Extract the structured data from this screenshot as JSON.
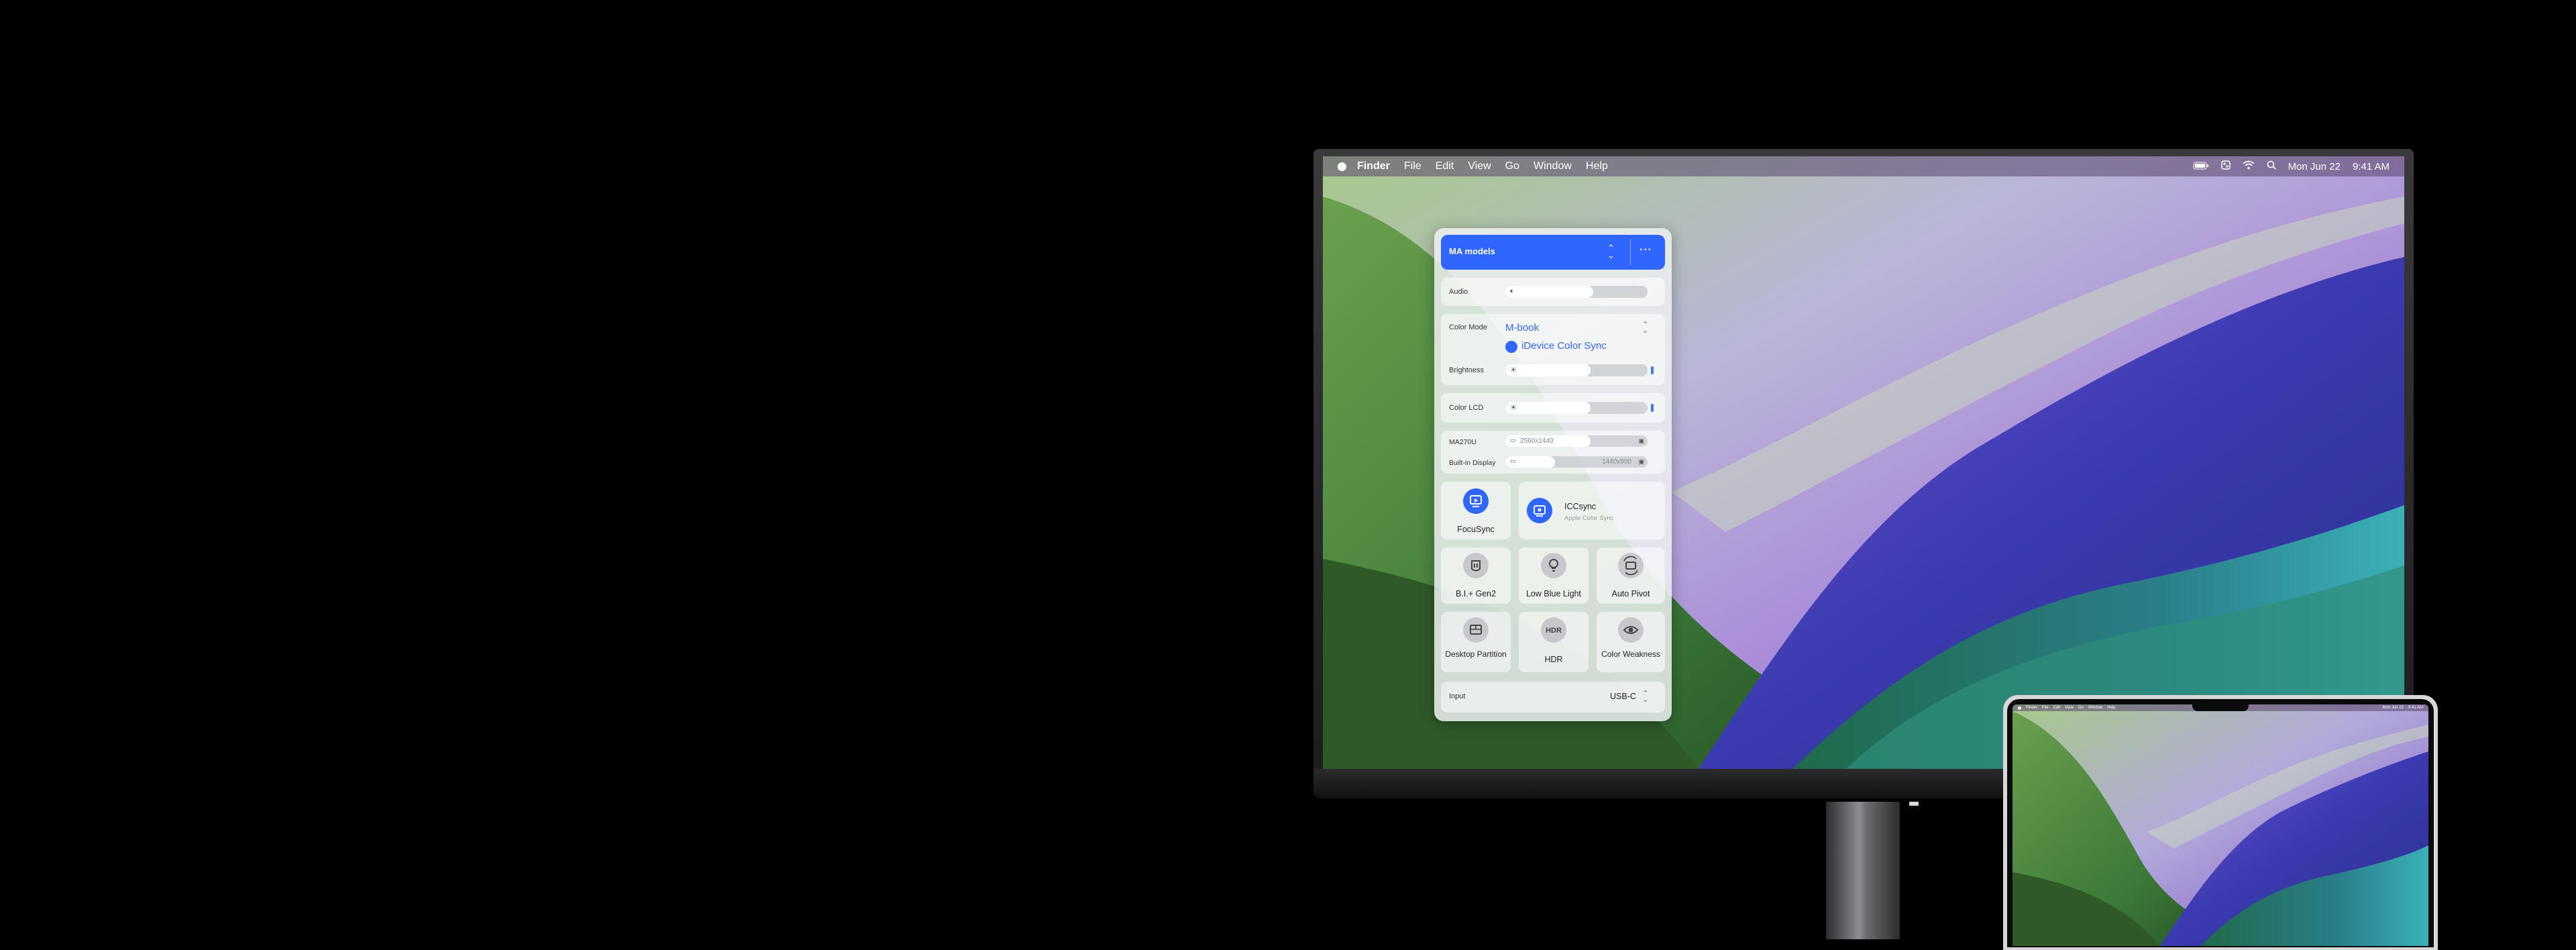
{
  "menubar": {
    "app": "Finder",
    "items": [
      "File",
      "Edit",
      "View",
      "Go",
      "Window",
      "Help"
    ],
    "date": "Mon Jun 22",
    "time": "9:41 AM",
    "status_icons": [
      "battery-icon",
      "control-center-icon",
      "wifi-icon",
      "search-icon"
    ]
  },
  "panel": {
    "header": {
      "title": "MA models",
      "more": "···"
    },
    "audio": {
      "label": "Audio",
      "level": 0.62
    },
    "color_mode": {
      "label": "Color Mode",
      "value": "M-book",
      "sync": "iDevice Color Sync"
    },
    "brightness": {
      "label": "Brightness",
      "level": 0.6
    },
    "color_lcd": {
      "label": "Color LCD",
      "level": 0.6
    },
    "displays": [
      {
        "label": "MA270U",
        "resolution": "2560x1440",
        "level": 0.6
      },
      {
        "label": "Built-in Display",
        "resolution": "1440x900",
        "level": 0.35
      }
    ],
    "focusync": {
      "label": "FocuSync"
    },
    "iccsync": {
      "label": "ICCsync",
      "sub": "Apple Color Sync"
    },
    "tiles": [
      {
        "label": "B.I.+ Gen2",
        "icon": "bi-sensor-icon"
      },
      {
        "label": "Low Blue Light",
        "icon": "bulb-icon"
      },
      {
        "label": "Auto Pivot",
        "icon": "rotate-icon"
      },
      {
        "label": "Desktop Partition",
        "icon": "partition-icon"
      },
      {
        "label": "HDR",
        "icon": "hdr-icon"
      },
      {
        "label": "Color Weakness",
        "icon": "eye-icon"
      }
    ],
    "input": {
      "label": "Input",
      "value": "USB-C"
    }
  },
  "laptop_menubar": {
    "app": "Finder",
    "items": [
      "File",
      "Edit",
      "View",
      "Go",
      "Window",
      "Help"
    ],
    "date": "Mon Jun 22",
    "time": "9:41 AM"
  }
}
